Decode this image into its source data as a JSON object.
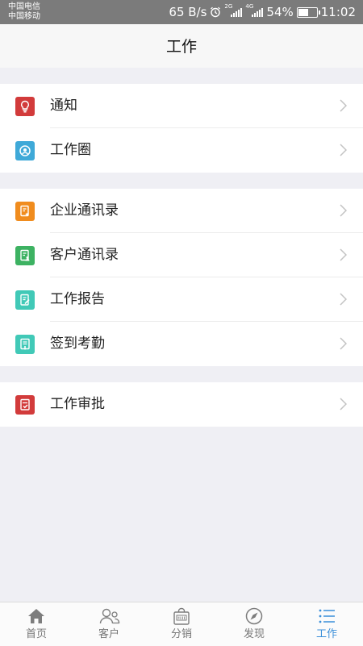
{
  "status_bar": {
    "carrier_1": "中国电信",
    "carrier_2": "中国移动",
    "net_speed": "65 B/s",
    "sim1_tag": "2G",
    "sim2_tag": "4G",
    "battery_percent": "54%",
    "battery_level": 0.54,
    "time": "11:02"
  },
  "header": {
    "title": "工作"
  },
  "menu": {
    "group1": [
      {
        "label": "通知",
        "icon": "bulb-icon",
        "color": "#d23b3b"
      },
      {
        "label": "工作圈",
        "icon": "circle-icon",
        "color": "#3fa9d8"
      }
    ],
    "group2": [
      {
        "label": "企业通讯录",
        "icon": "company-contacts-icon",
        "color": "#f08c1e"
      },
      {
        "label": "客户通讯录",
        "icon": "customer-contacts-icon",
        "color": "#3db262"
      },
      {
        "label": "工作报告",
        "icon": "report-icon",
        "color": "#41c9b7"
      },
      {
        "label": "签到考勤",
        "icon": "attendance-icon",
        "color": "#41c9b7"
      }
    ],
    "group3": [
      {
        "label": "工作审批",
        "icon": "approval-icon",
        "color": "#d23b3b"
      }
    ]
  },
  "tabs": [
    {
      "label": "首页",
      "icon": "home-icon"
    },
    {
      "label": "客户",
      "icon": "customer-icon"
    },
    {
      "label": "分销",
      "icon": "sale-bag-icon"
    },
    {
      "label": "发现",
      "icon": "compass-icon"
    },
    {
      "label": "工作",
      "icon": "list-icon",
      "active": true
    }
  ],
  "colors": {
    "accent": "#3b8fd9",
    "background": "#efeff4"
  }
}
